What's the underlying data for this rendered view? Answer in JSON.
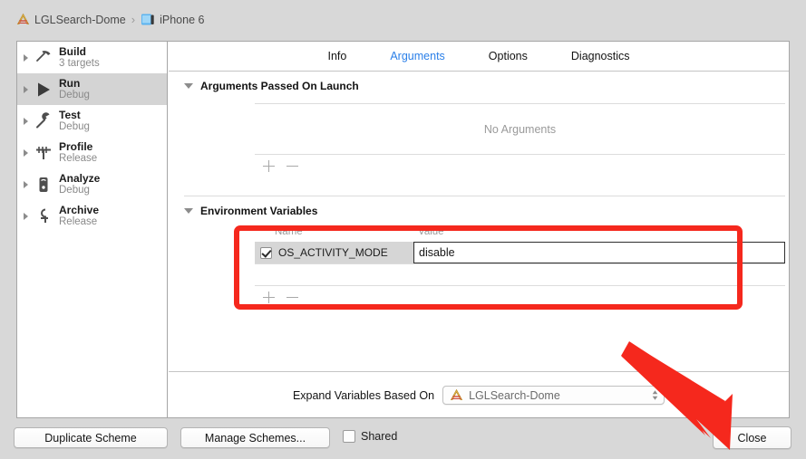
{
  "breadcrumb": {
    "scheme_icon": "xcode-scheme-icon",
    "scheme": "LGLSearch-Dome",
    "separator": "›",
    "device_icon": "iphone-simulator-icon",
    "device": "iPhone 6"
  },
  "sidebar": {
    "items": [
      {
        "title": "Build",
        "subtitle": "3 targets",
        "icon": "hammer-icon",
        "selected": false
      },
      {
        "title": "Run",
        "subtitle": "Debug",
        "icon": "play-icon",
        "selected": true
      },
      {
        "title": "Test",
        "subtitle": "Debug",
        "icon": "wrench-icon",
        "selected": false
      },
      {
        "title": "Profile",
        "subtitle": "Release",
        "icon": "gauge-icon",
        "selected": false
      },
      {
        "title": "Analyze",
        "subtitle": "Debug",
        "icon": "microscope-icon",
        "selected": false
      },
      {
        "title": "Archive",
        "subtitle": "Release",
        "icon": "archive-icon",
        "selected": false
      }
    ]
  },
  "tabs": [
    {
      "label": "Info",
      "active": false
    },
    {
      "label": "Arguments",
      "active": true
    },
    {
      "label": "Options",
      "active": false
    },
    {
      "label": "Diagnostics",
      "active": false
    }
  ],
  "arguments_section": {
    "title": "Arguments Passed On Launch",
    "empty_text": "No Arguments",
    "add_label": "+",
    "remove_label": "−"
  },
  "environment_section": {
    "title": "Environment Variables",
    "columns": {
      "name": "Name",
      "value": "Value"
    },
    "rows": [
      {
        "enabled": true,
        "name": "OS_ACTIVITY_MODE",
        "value": "disable"
      }
    ],
    "add_label": "+",
    "remove_label": "−"
  },
  "expand_variables": {
    "label": "Expand Variables Based On",
    "selected": "LGLSearch-Dome",
    "icon": "xcode-scheme-icon",
    "chevron": "up-down-chevron-icon"
  },
  "footer": {
    "duplicate_scheme": "Duplicate Scheme",
    "manage_schemes": "Manage Schemes...",
    "shared_label": "Shared",
    "shared_checked": false,
    "close": "Close"
  },
  "annotations": {
    "highlight_color": "#f5281d",
    "arrow_color": "#f5281d",
    "highlight_target": "environment-variables-table",
    "arrow_target": "close-button"
  }
}
